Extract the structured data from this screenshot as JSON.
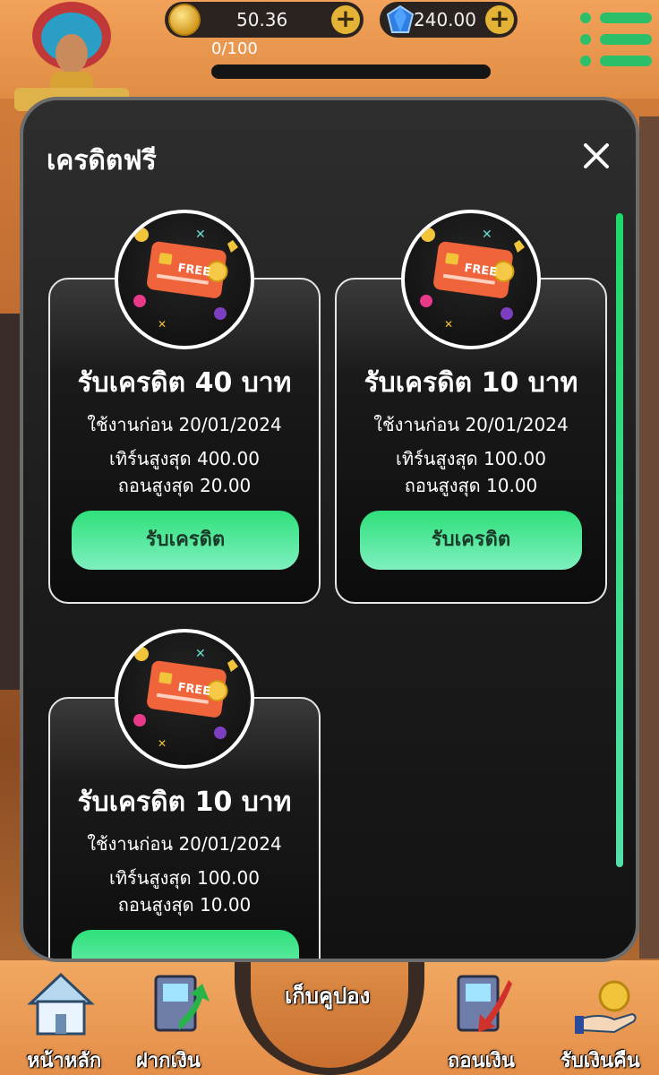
{
  "header": {
    "coin_balance": "50.36",
    "gem_balance": "240.00",
    "progress": "0/100",
    "progress_fraction": 0.0
  },
  "modal": {
    "title": "เครดิตฟรี",
    "card_image_text": "FREE",
    "cards": [
      {
        "title": "รับเครดิต 40 บาท",
        "use_before": "ใช้งานก่อน 20/01/2024",
        "max_turnover": "เทิร์นสูงสุด 400.00",
        "max_withdraw": "ถอนสูงสุด 20.00",
        "button": "รับเครดิต"
      },
      {
        "title": "รับเครดิต 10 บาท",
        "use_before": "ใช้งานก่อน 20/01/2024",
        "max_turnover": "เทิร์นสูงสุด 100.00",
        "max_withdraw": "ถอนสูงสุด 10.00",
        "button": "รับเครดิต"
      },
      {
        "title": "รับเครดิต 10 บาท",
        "use_before": "ใช้งานก่อน 20/01/2024",
        "max_turnover": "เทิร์นสูงสุด 100.00",
        "max_withdraw": "ถอนสูงสุด 10.00",
        "button": ""
      }
    ]
  },
  "bottom_nav": {
    "items": [
      {
        "label": "หน้าหลัก",
        "icon": "house-icon"
      },
      {
        "label": "ฝากเงิน",
        "icon": "atm-deposit-icon"
      },
      {
        "label": "เก็บคูปอง",
        "icon": "coupon-icon"
      },
      {
        "label": "ถอนเงิน",
        "icon": "atm-withdraw-icon"
      },
      {
        "label": "รับเงินคืน",
        "icon": "cashback-icon"
      }
    ]
  },
  "colors": {
    "accent_green": "#2fe07a",
    "modal_bg": "#1e1e1e",
    "nav_orange": "#e48e49"
  }
}
